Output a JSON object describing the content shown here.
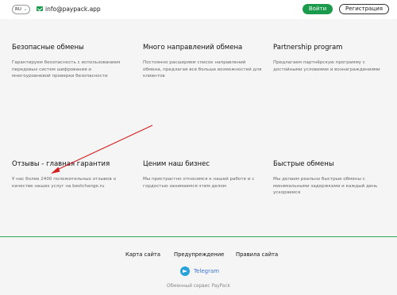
{
  "header": {
    "language": "RU",
    "email": "info@paypack.app",
    "login_label": "Войти",
    "register_label": "Регистрация"
  },
  "features": [
    {
      "title": "Безопасные обмены",
      "text": "Гарантируем безопасность с использованием передовых систем шифрования и многоуровневой проверки безопасности"
    },
    {
      "title": "Много направлений обмена",
      "text": "Постоянно расширяем список направлений обмена, предлагая все больше возможностей для клиентов"
    },
    {
      "title": "Partnership program",
      "text": "Предлагаем партнёрскую программу с достойными условиями и вознаграждениями"
    },
    {
      "title": "Отзывы - главная гарантия",
      "text": "У нас более 2400 положительных отзывов о качестве наших услуг на bestchange.ru"
    },
    {
      "title": "Ценим наш бизнес",
      "text": "Мы пристрастно относимся к нашей работе и с гордостью занимаемся этим делом"
    },
    {
      "title": "Быстрые обмены",
      "text": "Мы делаем реально быстрые обмены с минимальными задержками и каждый день ускоряемся"
    }
  ],
  "footer": {
    "links": [
      "Карта сайта",
      "Предупреждение",
      "Правила сайта"
    ],
    "telegram_label": "Telegram",
    "service_label": "Обменный сервис PayPack"
  },
  "colors": {
    "brand_green": "#1a9a4b",
    "annotation_red": "#d42020",
    "telegram_blue": "#29a2dc"
  }
}
